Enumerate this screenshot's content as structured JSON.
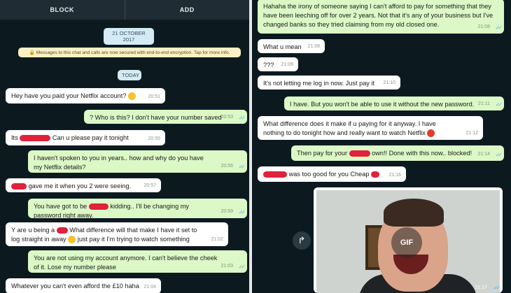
{
  "left": {
    "topbar": {
      "block_label": "BLOCK",
      "add_label": "ADD"
    },
    "date_pill": "21 OCTOBER 2017",
    "encryption_notice": "Messages to this chat and calls are now secured with end-to-end encryption. Tap for more info.",
    "today_pill": "TODAY",
    "messages": [
      {
        "text": "Hey have you paid your Netflix account?",
        "time": "20:51"
      },
      {
        "text": "? Who is this? I don't have your number saved",
        "time": "20:53"
      },
      {
        "pre": "Its",
        "text": "Can u please pay it tonight",
        "time": "20:55"
      },
      {
        "text": "I haven't spoken to you in years.. how and why do you have my Netflix details?",
        "time": "20:56"
      },
      {
        "text": "gave me it when you 2 were seeing.",
        "time": "20:57"
      },
      {
        "pre": "You have got to be",
        "text": "kidding.. I'll be changing my password right away.",
        "time": "20:59"
      },
      {
        "pre": "Y are u being a",
        "text": "What difference will that make I have it set to log straight in away",
        "post": "just pay it I'm trying to watch something",
        "time": "21:02"
      },
      {
        "text": "You are not using my account anymore. I can't believe the cheek of it. Lose my number please",
        "time": "21:03"
      },
      {
        "text": "Whatever you can't even afford the £10 haha",
        "time": "21:04"
      }
    ]
  },
  "right": {
    "messages": [
      {
        "text": "Hahaha the irony of someone saying I can't afford to pay for something that they have been leeching off for over 2 years. Not that it's any of your business but I've changed banks so they tried claiming from my old closed one.",
        "time": "21:08"
      },
      {
        "text": "What u mean",
        "time": "21:08"
      },
      {
        "text": "???",
        "time": "21:09"
      },
      {
        "text": "It's not letting me log in now. Just pay it",
        "time": "21:10"
      },
      {
        "text": "I have. But you won't be able to use it without the new password.",
        "time": "21:11"
      },
      {
        "text": "What difference does it make if u paying for it anyway. I have nothing to do tonight how and really want to watch Netflix",
        "time": "21:12"
      },
      {
        "pre": "Then pay for your",
        "text": "own!! Done with this now.. blocked!",
        "time": "21:14"
      },
      {
        "text": "was too good for you Cheap",
        "time": "21:16"
      }
    ],
    "media": {
      "badge": "GIF",
      "time": "21:17"
    }
  },
  "icons": {
    "ticks": "✓✓",
    "share": "↱"
  }
}
